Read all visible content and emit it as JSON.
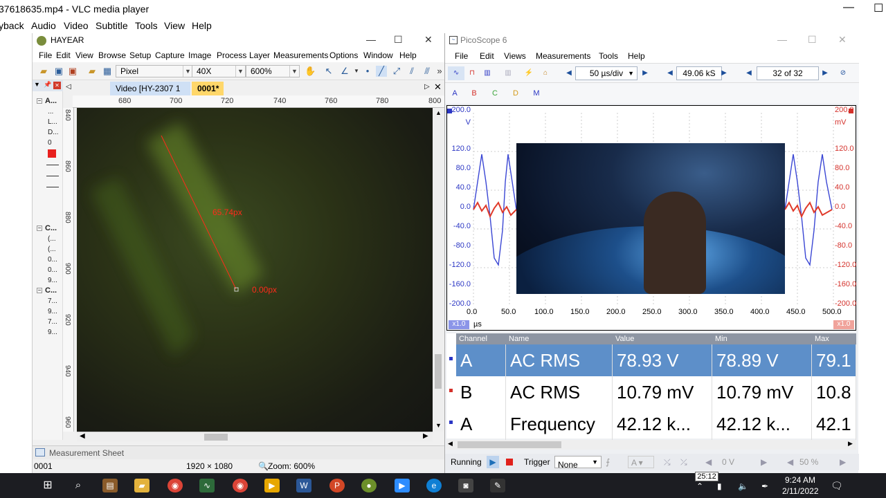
{
  "vlc": {
    "title": "37618635.mp4 - VLC media player",
    "menu": [
      "yback",
      "Audio",
      "Video",
      "Subtitle",
      "Tools",
      "View",
      "Help"
    ],
    "minimize": "—",
    "maximize": "☐"
  },
  "hayear": {
    "title": "HAYEAR",
    "menu": [
      "File",
      "Edit",
      "View",
      "Browse",
      "Setup",
      "Capture",
      "Image",
      "Process",
      "Layer",
      "Measurements",
      "Options",
      "Window",
      "Help"
    ],
    "toolbar": {
      "unit": "Pixel",
      "objective": "40X",
      "zoom": "600%"
    },
    "left_panel": {
      "groups": [
        {
          "label": "A...",
          "items": [
            "...",
            "L...",
            "D...",
            "0"
          ]
        },
        {
          "label": "C...",
          "items": [
            "(...",
            "(...",
            "0...",
            "0...",
            "9..."
          ]
        },
        {
          "label": "C...",
          "items": [
            "7...",
            "9...",
            "7...",
            "9..."
          ]
        }
      ]
    },
    "tabs": [
      "Video [HY-2307 1",
      "0001*"
    ],
    "ruler_x": [
      "680",
      "700",
      "720",
      "740",
      "760",
      "780",
      "800"
    ],
    "ruler_y": [
      "840",
      "860",
      "880",
      "900",
      "920",
      "940",
      "960"
    ],
    "measurement": {
      "length_label": "65.74px",
      "end_label": "0.00px"
    },
    "measurement_sheet": "Measurement Sheet",
    "status": {
      "frame": "0001",
      "resolution": "1920 × 1080",
      "zoom": "Zoom: 600%"
    }
  },
  "picoscope": {
    "title": "PicoScope 6",
    "menu": [
      "File",
      "Edit",
      "Views",
      "Measurements",
      "Tools",
      "Help"
    ],
    "timebase": "50 µs/div",
    "samples": "49.06 kS",
    "buffer": "32 of 32",
    "channels": [
      "A",
      "B",
      "C",
      "D"
    ],
    "y_left": [
      "200.0",
      "V",
      "120.0",
      "80.0",
      "40.0",
      "0.0",
      "-40.0",
      "-80.0",
      "-120.0",
      "-160.0",
      "-200.0"
    ],
    "y_right": [
      "200.0",
      "mV",
      "120.0",
      "80.0",
      "40.0",
      "0.0",
      "-40.0",
      "-80.0",
      "-120.0",
      "-160.0",
      "-200.0"
    ],
    "x_ticks": [
      "0.0",
      "50.0",
      "100.0",
      "150.0",
      "200.0",
      "250.0",
      "300.0",
      "350.0",
      "400.0",
      "450.0",
      "500.0"
    ],
    "x_unit": "µs",
    "scale_left": "x1.0",
    "scale_right": "x1.0",
    "table": {
      "headers": [
        "Channel",
        "Name",
        "Value",
        "Min",
        "Max"
      ],
      "rows": [
        [
          "A",
          "AC RMS",
          "78.93 V",
          "78.89 V",
          "79.1"
        ],
        [
          "B",
          "AC RMS",
          "10.79 mV",
          "10.79 mV",
          "10.8"
        ],
        [
          "A",
          "Frequency",
          "42.12 k...",
          "42.12 k...",
          "42.1"
        ]
      ]
    },
    "status": {
      "running": "Running",
      "trigger": "Trigger",
      "trigger_mode": "None",
      "level": "0 V",
      "percent": "50 %"
    }
  },
  "taskbar": {
    "time": "9:24 AM",
    "date": "2/11/2022",
    "overlay_timer": "25:12"
  },
  "colors": {
    "channel_a": "#2b36c4",
    "channel_b": "#d4312b",
    "accent": "#1d6fb8"
  }
}
